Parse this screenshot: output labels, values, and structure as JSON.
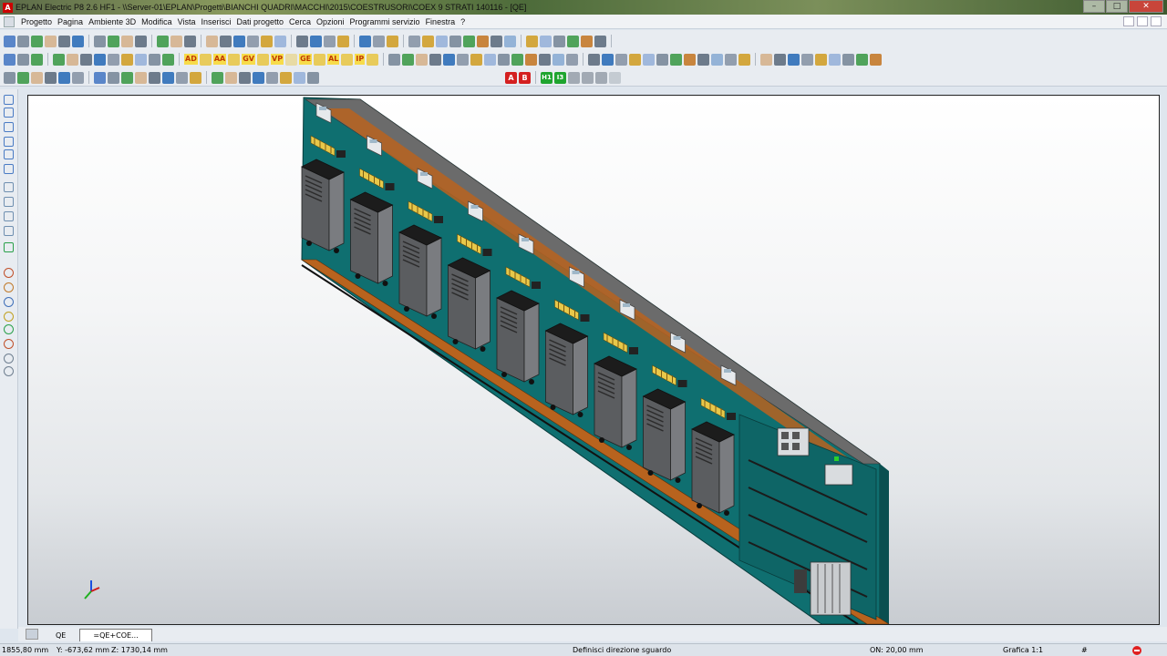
{
  "window": {
    "title": "EPLAN Electric P8 2.6 HF1 - \\\\Server-01\\EPLAN\\Progetti\\BIANCHI QUADRI\\MACCHI\\2015\\COESTRUSORI\\COEX 9 STRATI 140116 - [QE]",
    "app_icon": "A",
    "minimize_label": "–",
    "maximize_label": "□",
    "close_label": "✕"
  },
  "menu": {
    "items": [
      "Progetto",
      "Pagina",
      "Ambiente 3D",
      "Modifica",
      "Vista",
      "Inserisci",
      "Dati progetto",
      "Cerca",
      "Opzioni",
      "Programmi servizio",
      "Finestra",
      "?"
    ]
  },
  "toolbar": {
    "labels": [
      "AD",
      "AA",
      "GV",
      "VP",
      "GE",
      "AL",
      "IP"
    ],
    "red_marks": [
      "A",
      "B"
    ],
    "green_marks": [
      "H1",
      "I3"
    ]
  },
  "tabs": {
    "items": [
      "QE",
      "=QE+COE..."
    ],
    "active_index": 1
  },
  "status": {
    "x": "1855,80 mm",
    "y": "Y: -673,62 mm",
    "z": "Z: 1730,14 mm",
    "message": "Definisci direzione sguardo",
    "on_grid": "ON: 20,00 mm",
    "scale": "Grafica 1:1",
    "hash": "#"
  },
  "colors": {
    "panel_teal": "#0f6f70",
    "panel_dark": "#0a4f50",
    "cabinet_gray": "#6d6f72",
    "wire_duct": "#b8631e",
    "terminal_yellow": "#e8c84a"
  },
  "icons": {
    "axis_gizmo": "xyz-axis-icon",
    "cursor": "mouse-pointer-icon"
  }
}
